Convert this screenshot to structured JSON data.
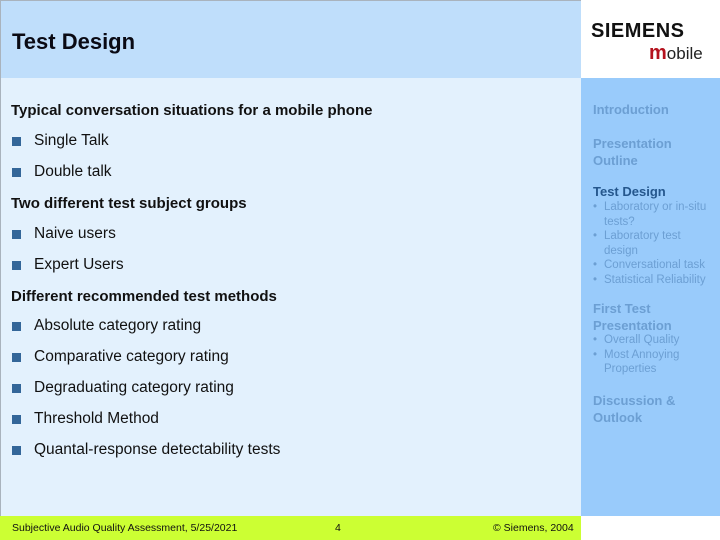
{
  "header": {
    "title": "Test Design"
  },
  "logo": {
    "brand": "SIEMENS",
    "sub_m": "m",
    "sub_rest": "obile"
  },
  "main": {
    "sections": [
      {
        "heading": "Typical conversation situations for a mobile phone",
        "items": [
          "Single Talk",
          "Double talk"
        ]
      },
      {
        "heading": "Two different test subject groups",
        "items": [
          "Naive users",
          "Expert Users"
        ]
      },
      {
        "heading": "Different recommended test methods",
        "items": [
          "Absolute category rating",
          "Comparative category rating",
          "Degraduating category rating",
          "Threshold Method",
          "Quantal-response detectability tests"
        ]
      }
    ]
  },
  "sidebar": {
    "items": [
      {
        "label": "Introduction",
        "active": false
      },
      {
        "label": "Presentation Outline",
        "active": false
      },
      {
        "label": "Test Design",
        "active": true,
        "subitems": [
          "Laboratory or in-situ tests?",
          "Laboratory test design",
          "Conversational task",
          "Statistical Reliability"
        ]
      },
      {
        "label": "First Test Presentation",
        "active": false,
        "subitems": [
          "Overall Quality",
          "Most Annoying Properties"
        ]
      },
      {
        "label": "Discussion & Outlook",
        "active": false
      }
    ]
  },
  "footer": {
    "left": "Subjective Audio Quality Assessment, 5/25/2021",
    "page": "4",
    "copyright": "© Siemens, 2004"
  },
  "colors": {
    "header_bg": "#bfdefb",
    "main_bg": "#e3f1fd",
    "sidebar_bg": "#99cbfb",
    "footer_bg": "#ccff33",
    "bullet": "#336699",
    "nav_active": "#25578d",
    "nav_inactive": "#6c9fd3",
    "logo_accent": "#b4121e"
  }
}
